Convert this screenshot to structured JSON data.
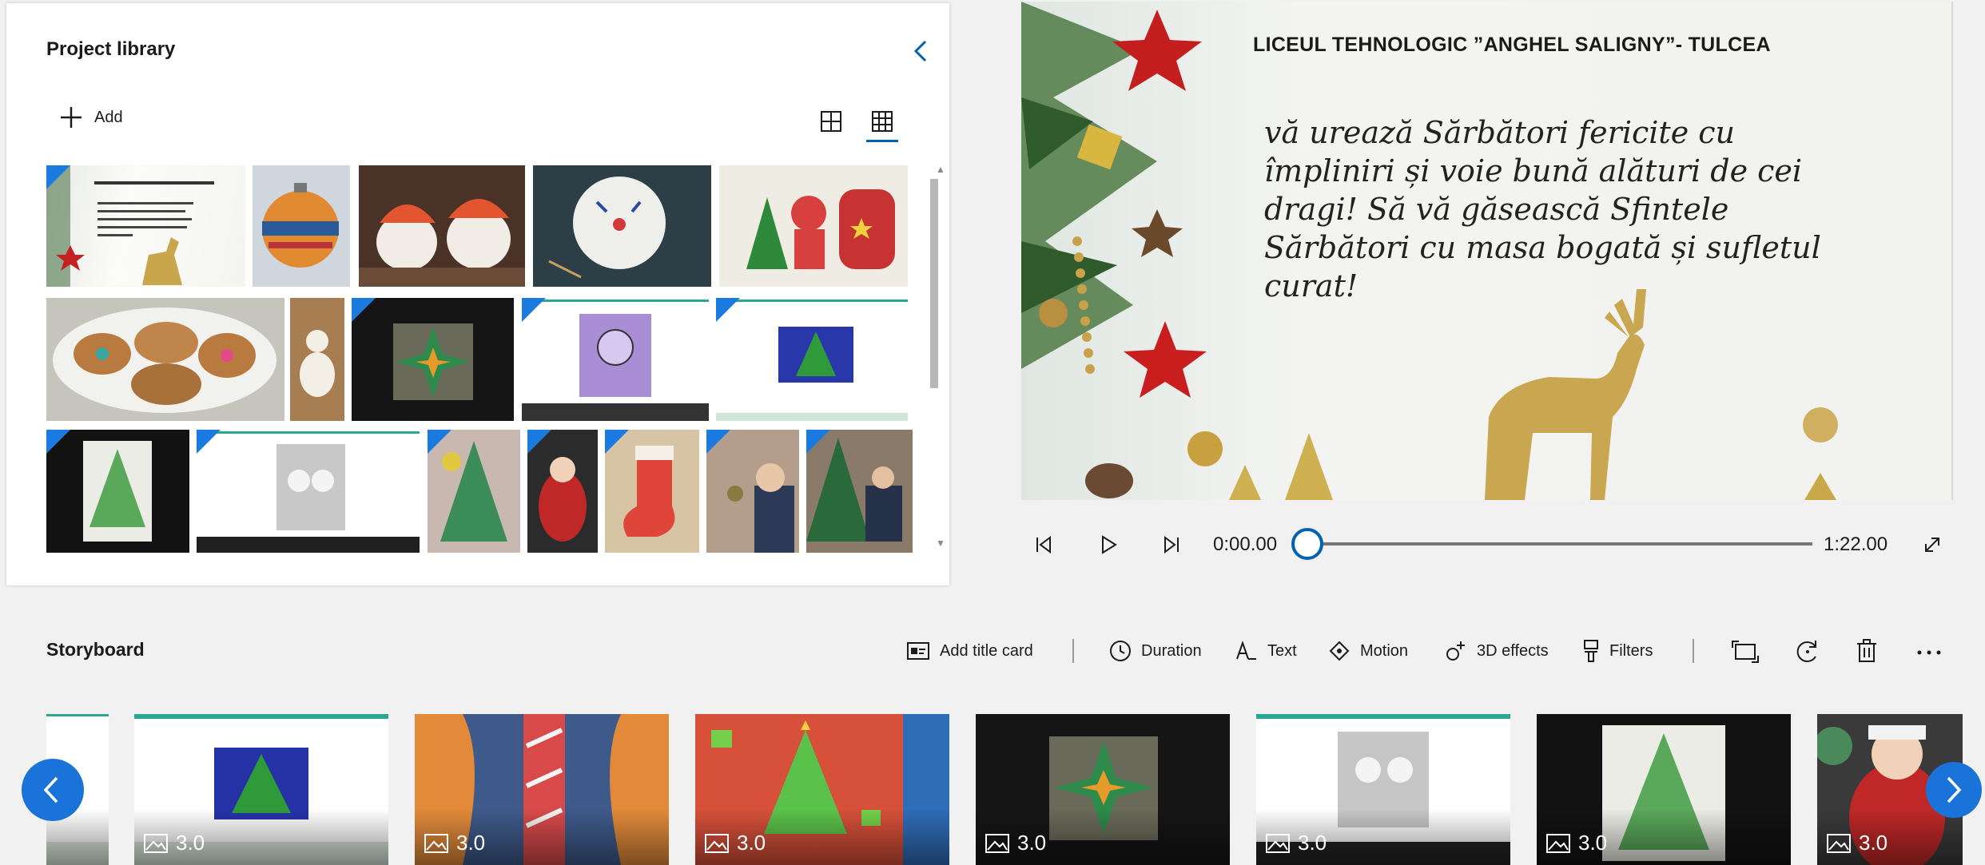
{
  "library": {
    "title": "Project library",
    "add_label": "Add"
  },
  "preview": {
    "title": "LICEUL TEHNOLOGIC ”ANGHEL SALIGNY”- TULCEA",
    "body": "vă urează Sărbători fericite cu împliniri și voie bună alături de cei dragi! Să vă găsească Sfintele Sărbători cu masa bogată și sufletul curat!"
  },
  "playback": {
    "current_time": "0:00.00",
    "total_time": "1:22.00",
    "progress": 0
  },
  "storyboard": {
    "title": "Storyboard",
    "tools": {
      "add_title_card": "Add title card",
      "duration": "Duration",
      "text": "Text",
      "motion": "Motion",
      "effects_3d": "3D effects",
      "filters": "Filters"
    },
    "clips": [
      {
        "duration": ""
      },
      {
        "duration": "3.0"
      },
      {
        "duration": "3.0"
      },
      {
        "duration": "3.0"
      },
      {
        "duration": "3.0"
      },
      {
        "duration": "3.0"
      },
      {
        "duration": "3.0"
      },
      {
        "duration": "3.0"
      }
    ]
  },
  "colors": {
    "accent": "#0063b1",
    "nav_button": "#1a73d9",
    "media_corner": "#1a7ae0"
  }
}
